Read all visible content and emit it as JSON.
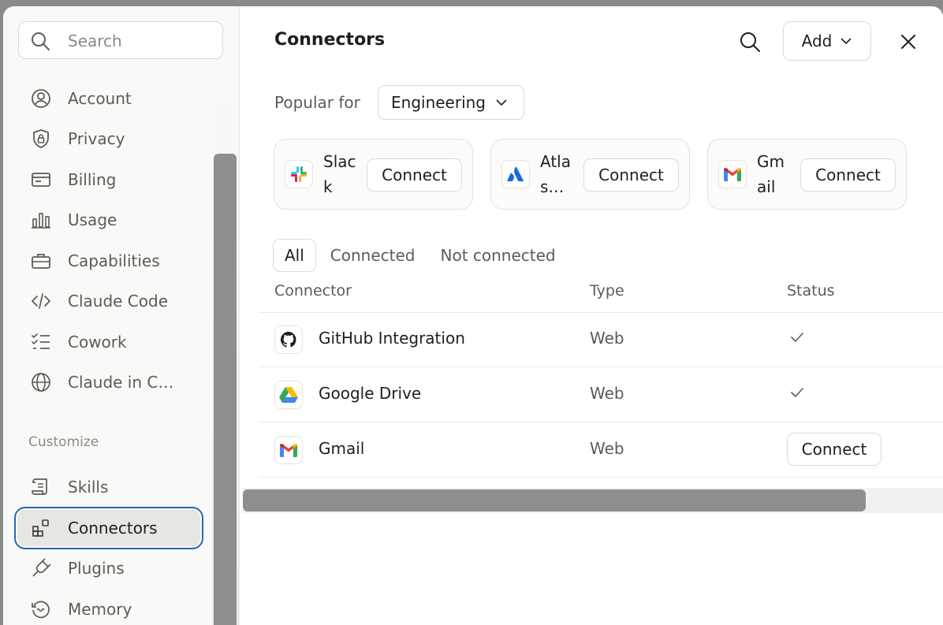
{
  "sidebar": {
    "search_placeholder": "Search",
    "items": [
      {
        "label": "Account",
        "icon": "account-icon"
      },
      {
        "label": "Privacy",
        "icon": "shield-icon"
      },
      {
        "label": "Billing",
        "icon": "card-icon"
      },
      {
        "label": "Usage",
        "icon": "bar-chart-icon"
      },
      {
        "label": "Capabilities",
        "icon": "briefcase-icon"
      },
      {
        "label": "Claude Code",
        "icon": "code-icon"
      },
      {
        "label": "Cowork",
        "icon": "checklist-icon"
      },
      {
        "label": "Claude in C…",
        "icon": "globe-icon"
      }
    ],
    "section_label": "Customize",
    "customize_items": [
      {
        "label": "Skills",
        "icon": "scroll-icon"
      },
      {
        "label": "Connectors",
        "icon": "connectors-icon",
        "active": true
      },
      {
        "label": "Plugins",
        "icon": "plug-icon"
      },
      {
        "label": "Memory",
        "icon": "memory-icon"
      }
    ]
  },
  "header": {
    "title": "Connectors",
    "add_label": "Add"
  },
  "popular": {
    "label": "Popular for",
    "selected": "Engineering",
    "cards": [
      {
        "name": "Slack",
        "button": "Connect",
        "icon": "slack-logo-icon"
      },
      {
        "name": "Atlas…",
        "button": "Connect",
        "icon": "atlassian-logo-icon"
      },
      {
        "name": "Gmail",
        "button": "Connect",
        "icon": "gmail-logo-icon"
      }
    ]
  },
  "tabs": [
    "All",
    "Connected",
    "Not connected"
  ],
  "table": {
    "columns": [
      "Connector",
      "Type",
      "Status"
    ],
    "rows": [
      {
        "name": "GitHub Integration",
        "type": "Web",
        "status": "connected",
        "icon": "github-logo-icon"
      },
      {
        "name": "Google Drive",
        "type": "Web",
        "status": "connected",
        "icon": "google-drive-logo-icon"
      },
      {
        "name": "Gmail",
        "type": "Web",
        "status": "Connect",
        "icon": "gmail-logo-icon"
      }
    ]
  },
  "colors": {
    "focus_ring": "#2666b8",
    "scroll_thumb": "#8e8e8e"
  }
}
